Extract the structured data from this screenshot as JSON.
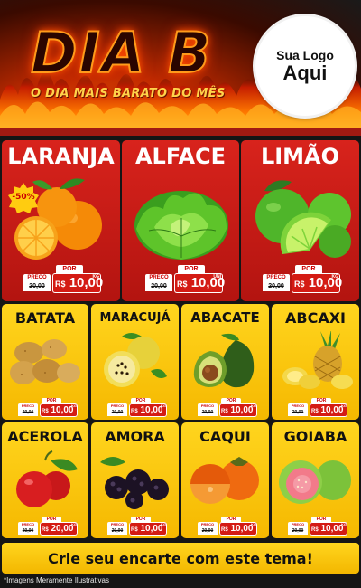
{
  "header": {
    "title": "DIA B",
    "subtitle": "O DIA MAIS BARATO DO MÊS",
    "logo_line1": "Sua Logo",
    "logo_line2": "Aqui"
  },
  "featured": [
    {
      "name": "LARANJA",
      "badge": "-50%",
      "preco_label": "PRECO",
      "old_price": "20,00",
      "por_label": "POR",
      "currency": "R$",
      "price": "10,00",
      "unit": "KG"
    },
    {
      "name": "ALFACE",
      "preco_label": "PRECO",
      "old_price": "20,00",
      "por_label": "POR",
      "currency": "R$",
      "price": "10,00",
      "unit": "UNI"
    },
    {
      "name": "LIMÃO",
      "preco_label": "PRECO",
      "old_price": "20,00",
      "por_label": "POR",
      "currency": "R$",
      "price": "10,00",
      "unit": "KG"
    }
  ],
  "grid": [
    {
      "name": "BATATA",
      "preco_label": "PRECO",
      "old_price": "20,00",
      "por_label": "POR",
      "currency": "R$",
      "price": "10,00",
      "unit": "KG"
    },
    {
      "name": "MARACUJÁ",
      "preco_label": "PRECO",
      "old_price": "20,00",
      "por_label": "POR",
      "currency": "R$",
      "price": "10,00",
      "unit": "KG"
    },
    {
      "name": "ABACATE",
      "preco_label": "PRECO",
      "old_price": "20,00",
      "por_label": "POR",
      "currency": "R$",
      "price": "10,00",
      "unit": "KG"
    },
    {
      "name": "ABCAXI",
      "preco_label": "PRECO",
      "old_price": "20,00",
      "por_label": "POR",
      "currency": "R$",
      "price": "10,00",
      "unit": "KG"
    },
    {
      "name": "ACEROLA",
      "preco_label": "PRECO",
      "old_price": "20,00",
      "por_label": "POR",
      "currency": "R$",
      "price": "20,00",
      "unit": "KG"
    },
    {
      "name": "AMORA",
      "preco_label": "PRECO",
      "old_price": "20,00",
      "por_label": "POR",
      "currency": "R$",
      "price": "10,00",
      "unit": "KG"
    },
    {
      "name": "CAQUI",
      "preco_label": "PRECO",
      "old_price": "20,00",
      "por_label": "POR",
      "currency": "R$",
      "price": "10,00",
      "unit": "KG"
    },
    {
      "name": "GOIABA",
      "preco_label": "PRECO",
      "old_price": "20,00",
      "por_label": "POR",
      "currency": "R$",
      "price": "10,00",
      "unit": "KG"
    }
  ],
  "footer": {
    "cta": "Crie seu encarte com este tema!",
    "disclaimer": "*Imagens Meramente Ilustrativas"
  },
  "colors": {
    "red_card": "#c81a14",
    "yellow_card": "#f8c60f",
    "fire": "#ff6a00"
  }
}
